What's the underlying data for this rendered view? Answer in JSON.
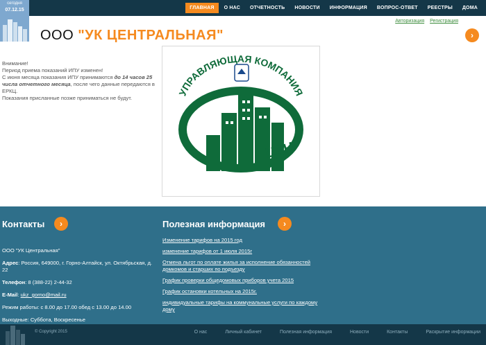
{
  "date": {
    "label": "сегодня",
    "value": "07.12.15"
  },
  "nav": [
    "ГЛАВНАЯ",
    "О НАС",
    "ОТЧЕТНОСТЬ",
    "НОВОСТИ",
    "ИНФОРМАЦИЯ",
    "ВОПРОС-ОТВЕТ",
    "РЕЕСТРЫ",
    "ДОМА"
  ],
  "header": {
    "title_prefix": "ООО",
    "title_name": "\"УК ЦЕНТРАЛЬНАЯ\"",
    "login": "Авторизация",
    "register": "Регистрация"
  },
  "notice": {
    "line1": "Внимание!",
    "line2": "Период приема показаний ИПУ изменен!",
    "line3a": "С июня месяца показания ИПУ принимаются ",
    "line3b": "до 14 часов 25 числа отчетного месяца",
    "line3c": ", после чего данные передаются в ЕРКЦ.",
    "line4": "Показания присланные позже приниматься не будут."
  },
  "logo": {
    "top_text": "УПРАВЛЯЮЩАЯ КОМПАНИЯ",
    "bottom_text": "ЦЕНТРАЛЬНАЯ"
  },
  "contacts": {
    "title": "Контакты",
    "company": "ООО \"УК Центральная\"",
    "address_label": "Адрес",
    "address": ": Россия, 649000, г. Горно-Алтайск, ул. Октябрьская, д. 22",
    "phone_label": "Телефон",
    "phone": ": 8 (388-22) 2-44-32",
    "email_label": "E-Mail",
    "email": "ukz_gorno@mail.ru",
    "hours": "Режим работы: с 8.00 до 17.00 обед с 13.00 до 14.00",
    "days_off": "Выходные: Суббота, Воскресенье"
  },
  "useful": {
    "title": "Полезная информация",
    "links": [
      "Изменение тарифов на 2015 год",
      "изменение тарифов от 1 июля 2015г",
      "Отмена льгот по оплате жилья за исполнение обязанностей домкомов и старших по подъезду",
      "График проверки общедомовых приборов учета 2015",
      "График остановки котельных на 2015г.",
      "индивидуальные тарифы на коммунальные услуги по каждому дому"
    ]
  },
  "footer": {
    "copyright": "© Copyright 2015",
    "nav": [
      "О нас",
      "Личный кабинет",
      "Полезная информация",
      "Новости",
      "Контакты",
      "Раскрытие информации"
    ]
  },
  "colors": {
    "accent": "#f58a1f",
    "dark": "#143748",
    "band": "#2f6f8a",
    "logo_green": "#0f6b3a"
  }
}
